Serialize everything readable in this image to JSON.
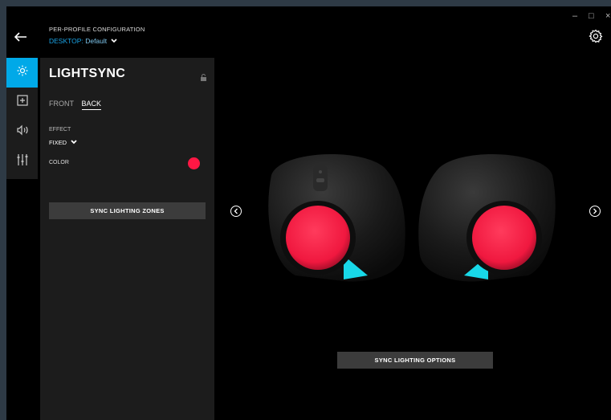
{
  "header": {
    "label": "PER-PROFILE CONFIGURATION",
    "profile_key": "DESKTOP:",
    "profile_value": "Default"
  },
  "window_controls": {
    "minimize": "–",
    "maximize": "□",
    "close": "×"
  },
  "sidebar": {
    "items": [
      {
        "icon": "lighting-icon",
        "active": true
      },
      {
        "icon": "assignments-icon",
        "active": false
      },
      {
        "icon": "speaker-audio-icon",
        "active": false
      },
      {
        "icon": "equalizer-icon",
        "active": false
      }
    ]
  },
  "panel": {
    "title": "LIGHTSYNC",
    "tabs": [
      {
        "label": "FRONT",
        "active": false
      },
      {
        "label": "BACK",
        "active": true
      }
    ],
    "effect_label": "EFFECT",
    "effect_value": "FIXED",
    "color_label": "COLOR",
    "color_value": "#ff1744",
    "sync_zones_label": "SYNC LIGHTING ZONES"
  },
  "main": {
    "sync_options_label": "SYNC LIGHTING OPTIONS"
  },
  "colors": {
    "accent": "#00a9e8",
    "led": "#ff1744",
    "underglow": "#18d8e8"
  }
}
